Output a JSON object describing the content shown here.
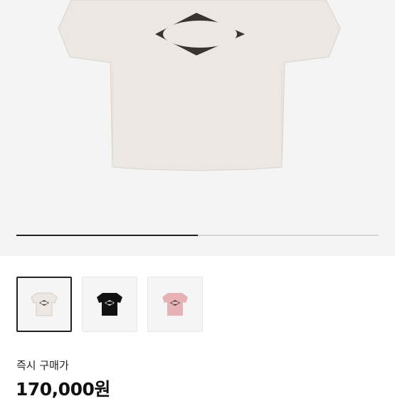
{
  "gallery": {
    "main_image": {
      "color": "#ece7e2",
      "icon": "tshirt-beige-icon"
    },
    "progress": 0.5,
    "thumbnails": [
      {
        "color": "#ece7e2",
        "icon": "tshirt-beige-icon",
        "selected": true
      },
      {
        "color": "#111111",
        "icon": "tshirt-black-icon",
        "selected": false
      },
      {
        "color": "#e6b2b6",
        "icon": "tshirt-pink-icon",
        "selected": false
      }
    ]
  },
  "purchase": {
    "instant_label": "즉시 구매가",
    "price": "170,000원"
  }
}
